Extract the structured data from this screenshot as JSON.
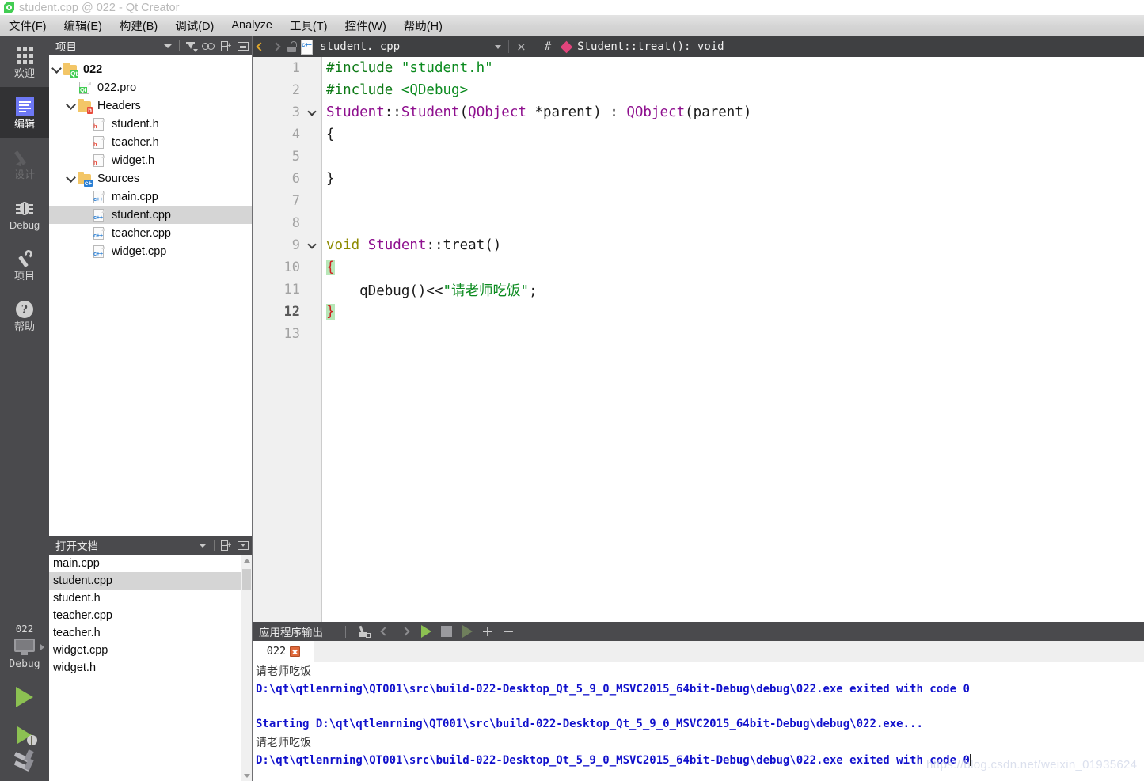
{
  "window": {
    "title": "student.cpp @ 022 - Qt Creator",
    "app_icon": "qt-logo-icon"
  },
  "menubar": {
    "items": [
      {
        "label": "文件(F)"
      },
      {
        "label": "编辑(E)"
      },
      {
        "label": "构建(B)"
      },
      {
        "label": "调试(D)"
      },
      {
        "label": "Analyze"
      },
      {
        "label": "工具(T)"
      },
      {
        "label": "控件(W)"
      },
      {
        "label": "帮助(H)"
      }
    ]
  },
  "modebar": {
    "items": [
      {
        "label": "欢迎",
        "icon": "grid-icon",
        "state": "normal"
      },
      {
        "label": "编辑",
        "icon": "document-icon",
        "state": "active"
      },
      {
        "label": "设计",
        "icon": "pencil-icon",
        "state": "disabled"
      },
      {
        "label": "Debug",
        "icon": "bug-icon",
        "state": "normal"
      },
      {
        "label": "项目",
        "icon": "wrench-icon",
        "state": "normal"
      },
      {
        "label": "帮助",
        "icon": "help-icon",
        "state": "normal"
      }
    ],
    "kit_selector": {
      "project": "022",
      "icon": "monitor-icon",
      "build_config": "Debug"
    },
    "run_button": {
      "icon": "play-icon",
      "label": "Run"
    },
    "debug_button": {
      "icon": "play-bug-icon",
      "label": "Start Debugging"
    },
    "build_button": {
      "icon": "hammer-icon",
      "label": "Build"
    }
  },
  "project_panel": {
    "header": {
      "title": "项目",
      "tools": [
        {
          "icon": "chevron-down-icon"
        },
        {
          "icon": "filter-icon"
        },
        {
          "icon": "link-icon"
        },
        {
          "icon": "split-add-icon"
        },
        {
          "icon": "minimize-panel-icon"
        }
      ]
    },
    "tree": [
      {
        "label": "022",
        "indent": 0,
        "icon": "folder-qt-icon",
        "expander": "expanded",
        "bold": true,
        "selected": false
      },
      {
        "label": "022.pro",
        "indent": 1,
        "icon": "file-qt-icon",
        "expander": "none",
        "bold": false,
        "selected": false
      },
      {
        "label": "Headers",
        "indent": 1,
        "icon": "folder-h-icon",
        "expander": "expanded",
        "bold": false,
        "selected": false
      },
      {
        "label": "student.h",
        "indent": 2,
        "icon": "file-h-icon",
        "expander": "none",
        "bold": false,
        "selected": false
      },
      {
        "label": "teacher.h",
        "indent": 2,
        "icon": "file-h-icon",
        "expander": "none",
        "bold": false,
        "selected": false
      },
      {
        "label": "widget.h",
        "indent": 2,
        "icon": "file-h-icon",
        "expander": "none",
        "bold": false,
        "selected": false
      },
      {
        "label": "Sources",
        "indent": 1,
        "icon": "folder-cpp-icon",
        "expander": "expanded",
        "bold": false,
        "selected": false
      },
      {
        "label": "main.cpp",
        "indent": 2,
        "icon": "file-cpp-icon",
        "expander": "none",
        "bold": false,
        "selected": false
      },
      {
        "label": "student.cpp",
        "indent": 2,
        "icon": "file-cpp-icon",
        "expander": "none",
        "bold": false,
        "selected": true
      },
      {
        "label": "teacher.cpp",
        "indent": 2,
        "icon": "file-cpp-icon",
        "expander": "none",
        "bold": false,
        "selected": false
      },
      {
        "label": "widget.cpp",
        "indent": 2,
        "icon": "file-cpp-icon",
        "expander": "none",
        "bold": false,
        "selected": false
      }
    ]
  },
  "open_documents_panel": {
    "header": {
      "title": "打开文档",
      "tools": [
        {
          "icon": "chevron-down-icon"
        },
        {
          "icon": "split-add-icon"
        },
        {
          "icon": "minimize-panel-icon"
        }
      ]
    },
    "items": [
      {
        "label": "main.cpp",
        "selected": false
      },
      {
        "label": "student.cpp",
        "selected": true
      },
      {
        "label": "student.h",
        "selected": false
      },
      {
        "label": "teacher.cpp",
        "selected": false
      },
      {
        "label": "teacher.h",
        "selected": false
      },
      {
        "label": "widget.cpp",
        "selected": false
      },
      {
        "label": "widget.h",
        "selected": false
      }
    ]
  },
  "editor": {
    "tabbar": {
      "back_icon": "chevron-left-icon",
      "forward_icon": "chevron-right-icon",
      "lock_icon": "unlocked-icon",
      "file_icon": "file-cpp-icon",
      "filename": "student. cpp",
      "dropdown_icon": "chevron-down-icon",
      "close_label": "×",
      "hash_label": "#",
      "symbol_icon": "diamond-icon",
      "symbol": "Student::treat(): void"
    },
    "current_line": 12,
    "lines": [
      {
        "n": 1,
        "fold": false,
        "tokens": [
          {
            "t": "#include ",
            "c": "pre"
          },
          {
            "t": "\"student.h\"",
            "c": "str"
          }
        ]
      },
      {
        "n": 2,
        "fold": false,
        "tokens": [
          {
            "t": "#include ",
            "c": "pre"
          },
          {
            "t": "<QDebug>",
            "c": "str"
          }
        ]
      },
      {
        "n": 3,
        "fold": true,
        "tokens": [
          {
            "t": "Student",
            "c": "cls"
          },
          {
            "t": "::",
            "c": "plain"
          },
          {
            "t": "Student",
            "c": "cls"
          },
          {
            "t": "(",
            "c": "plain"
          },
          {
            "t": "QObject",
            "c": "cls"
          },
          {
            "t": " *parent) : ",
            "c": "plain"
          },
          {
            "t": "QObject",
            "c": "cls"
          },
          {
            "t": "(parent)",
            "c": "plain"
          }
        ]
      },
      {
        "n": 4,
        "fold": false,
        "tokens": [
          {
            "t": "{",
            "c": "plain"
          }
        ]
      },
      {
        "n": 5,
        "fold": false,
        "tokens": []
      },
      {
        "n": 6,
        "fold": false,
        "tokens": [
          {
            "t": "}",
            "c": "plain"
          }
        ]
      },
      {
        "n": 7,
        "fold": false,
        "tokens": []
      },
      {
        "n": 8,
        "fold": false,
        "tokens": []
      },
      {
        "n": 9,
        "fold": true,
        "tokens": [
          {
            "t": "void",
            "c": "kw"
          },
          {
            "t": " ",
            "c": "plain"
          },
          {
            "t": "Student",
            "c": "cls"
          },
          {
            "t": "::treat()",
            "c": "plain"
          }
        ]
      },
      {
        "n": 10,
        "fold": false,
        "tokens": [
          {
            "t": "{",
            "c": "brace"
          }
        ]
      },
      {
        "n": 11,
        "fold": false,
        "tokens": [
          {
            "t": "    qDebug()<<",
            "c": "plain"
          },
          {
            "t": "\"请老师吃饭\"",
            "c": "str"
          },
          {
            "t": ";",
            "c": "plain"
          }
        ]
      },
      {
        "n": 12,
        "fold": false,
        "tokens": [
          {
            "t": "}",
            "c": "brace"
          }
        ]
      },
      {
        "n": 13,
        "fold": false,
        "tokens": []
      }
    ]
  },
  "output_pane": {
    "header": {
      "title": "应用程序输出",
      "tools": [
        {
          "icon": "clear-broom-icon"
        },
        {
          "icon": "chevron-left-icon"
        },
        {
          "icon": "chevron-right-icon"
        },
        {
          "icon": "play-icon"
        },
        {
          "icon": "stop-icon"
        },
        {
          "icon": "play-bug-icon"
        },
        {
          "icon": "zoom-in-plus-icon"
        },
        {
          "icon": "zoom-out-minus-icon"
        }
      ]
    },
    "tab": {
      "label": "022",
      "close_icon": "close-icon"
    },
    "lines": [
      {
        "text": "请老师吃饭",
        "style": "cn"
      },
      {
        "text": "D:\\qt\\qtlenrning\\QT001\\src\\build-022-Desktop_Qt_5_9_0_MSVC2015_64bit-Debug\\debug\\022.exe exited with code 0",
        "style": "blue"
      },
      {
        "text": "",
        "style": "gap"
      },
      {
        "text": "Starting D:\\qt\\qtlenrning\\QT001\\src\\build-022-Desktop_Qt_5_9_0_MSVC2015_64bit-Debug\\debug\\022.exe...",
        "style": "blue"
      },
      {
        "text": "请老师吃饭",
        "style": "cn"
      },
      {
        "text": "D:\\qt\\qtlenrning\\QT001\\src\\build-022-Desktop_Qt_5_9_0_MSVC2015_64bit-Debug\\debug\\022.exe exited with code 0",
        "style": "blue"
      }
    ]
  },
  "watermark": {
    "text": "https://blog.csdn.net/weixin_01935624"
  },
  "colors": {
    "mode_bar_bg": "#4a4a4d",
    "panel_header_bg": "#4a4a4d",
    "tabbar_bg": "#3f4042",
    "selection_bg": "#d5d5d5",
    "accent_green": "#8cc152",
    "string_green": "#0a8a1e",
    "class_purple": "#8e0f8e",
    "keyword_olive": "#8d8a00",
    "brace_highlight": "#b7e7b7",
    "brace_red": "#cf2020",
    "output_blue": "#1111cc",
    "diamond_pink": "#e0447c"
  }
}
